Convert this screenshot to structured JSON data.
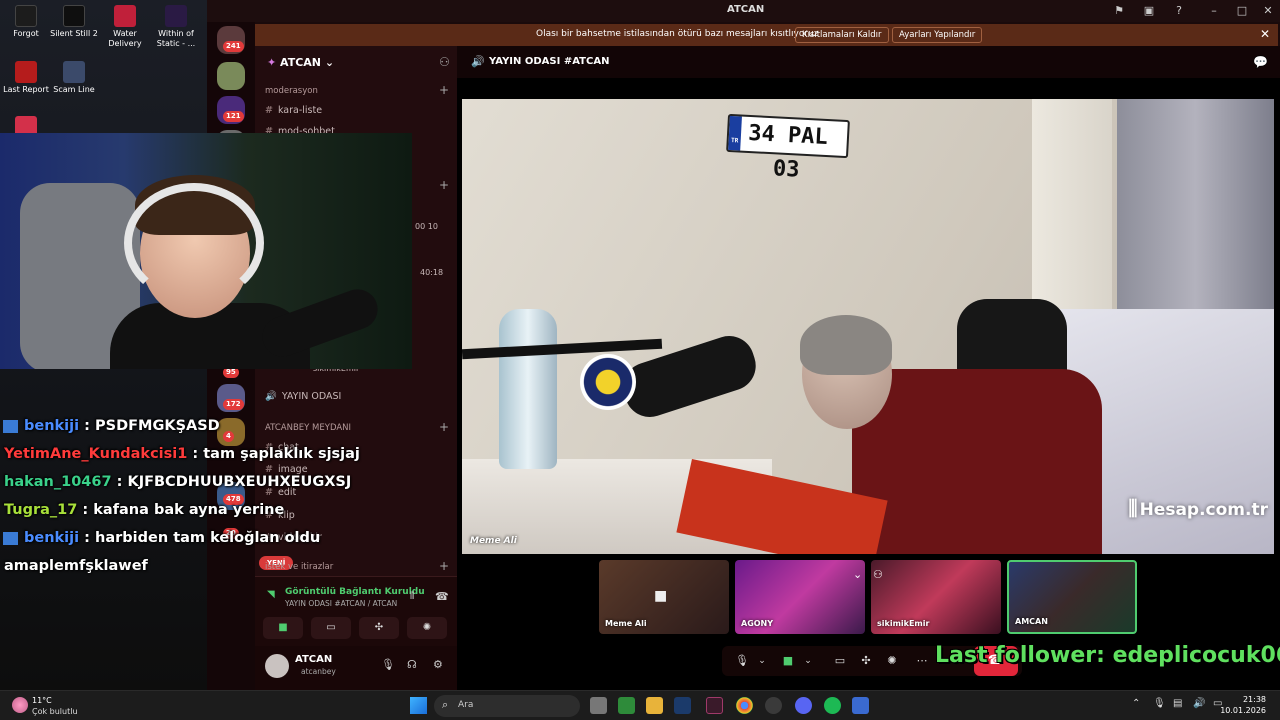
{
  "desktop": {
    "icons": [
      {
        "label": "Forgot",
        "color": "#1c1c1c"
      },
      {
        "label": "Silent Still 2",
        "color": "#0f0f0f"
      },
      {
        "label": "Water Delivery",
        "color": "#c0203a"
      },
      {
        "label": "Within of Static - ...",
        "color": "#2a1a44"
      },
      {
        "label": "Last Report",
        "color": "#b51c1c"
      },
      {
        "label": "Scam Line",
        "color": "#3b4a6a"
      }
    ]
  },
  "window": {
    "title": "ATCAN"
  },
  "notice": {
    "message": "Olası bir bahsetme istilasından ötürü bazı mesajları kısıtlıyoruz",
    "remove_button": "Kısıtlamaları Kaldır",
    "settings_button": "Ayarları Yapılandır"
  },
  "guilds": {
    "badges": [
      "241",
      "121",
      "95",
      "172",
      "4",
      "478",
      "20"
    ]
  },
  "server": {
    "name": "ATCAN",
    "categories": {
      "moderation": "moderasyon",
      "meydan": "ATCANBEY MEYDANI",
      "istek": "istek ve itirazlar"
    },
    "channels": {
      "kara_liste": "kara-liste",
      "mod_sohbet": "mod-sohbet",
      "sikimik": "sikimikEmir",
      "yayin_odasi": "YAYIN ODASI",
      "chat": "chat",
      "image": "image",
      "edit": "edit",
      "klip": "klip",
      "videofikir": "videofikir"
    },
    "new_badge": "YENİ",
    "misc_times": [
      "00",
      "10",
      "40:18"
    ]
  },
  "voice": {
    "status": "Görüntülü Bağlantı Kuruldu",
    "sub": "YAYIN ODASI #ATCAN / ATCAN"
  },
  "user": {
    "name": "ATCAN",
    "tag": "atcanbey"
  },
  "main": {
    "channel": "YAYIN ODASI #ATCAN",
    "plate": "34 PAL 03",
    "plate_country": "TR",
    "stage_label": "Meme Ali",
    "watermark": "Hesap.com.tr",
    "tiles": [
      "Meme Ali",
      "AGONY",
      "sikimikEmir",
      "AMCAN"
    ]
  },
  "stream_overlay": {
    "chat": [
      {
        "user": "benkiji",
        "text": "PSDFMGKŞASD",
        "badge": true,
        "color": "#4a8cff"
      },
      {
        "user": "YetimAne_Kundakcisi1",
        "text": "tam şaplaklık sjsjaj",
        "badge": false,
        "color": "#ff3b3b"
      },
      {
        "user": "hakan_10467",
        "text": "KJFBCDHUUBXEUHXEUGXSJ",
        "badge": false,
        "color": "#3ad18a"
      },
      {
        "user": "Tugra_17",
        "text": "kafana bak ayna yerine",
        "badge": false,
        "color": "#a8e03a"
      },
      {
        "user": "benkiji",
        "text": "harbiden tam keloğlan oldu",
        "badge": true,
        "color": "#4a8cff"
      },
      {
        "user": "",
        "text": "amaplemfşklawef",
        "badge": false,
        "color": "#ffffff"
      }
    ],
    "last_follower": "Last follower: edeplicocuk06"
  },
  "taskbar": {
    "temp": "11°C",
    "condition": "Çok bulutlu",
    "search": "Ara",
    "time": "21:38",
    "date": "10.01.2026"
  }
}
